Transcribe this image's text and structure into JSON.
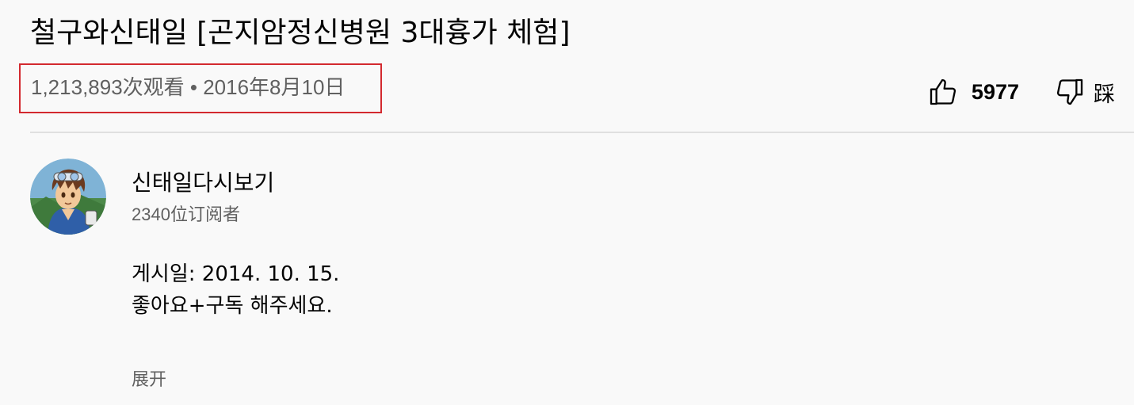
{
  "video": {
    "title": "철구와신태일 [곤지암정신병원 3대흉가 체험]",
    "meta": "1,213,893次观看 • 2016年8月10日"
  },
  "actions": {
    "like_count": "5977",
    "dislike_label": "踩"
  },
  "channel": {
    "name": "신태일다시보기",
    "subscribers": "2340位订阅者"
  },
  "description": {
    "lines": [
      "게시일: 2014. 10. 15.",
      "좋아요+구독 해주세요."
    ],
    "expand_label": "展开"
  },
  "colors": {
    "highlight_border": "#d3292f",
    "secondary_text": "#606060",
    "background": "#f9f9f9"
  },
  "icons": {
    "like": "thumbs-up-icon",
    "dislike": "thumbs-down-icon",
    "avatar": "channel-avatar"
  }
}
